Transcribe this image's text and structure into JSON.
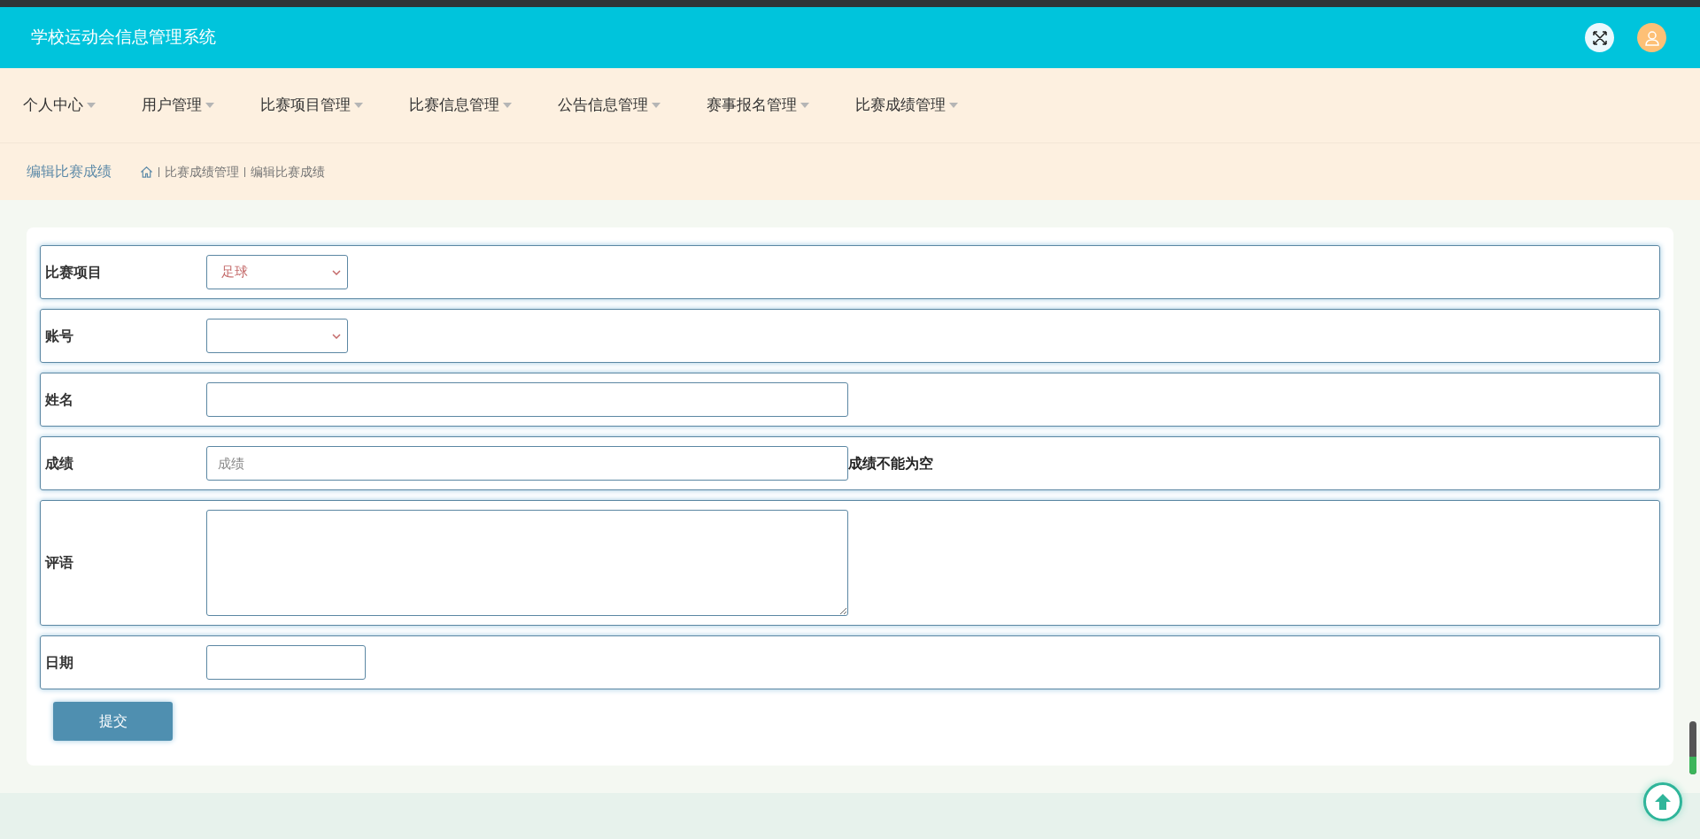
{
  "header": {
    "title": "学校运动会信息管理系统"
  },
  "nav": {
    "items": [
      {
        "label": "个人中心"
      },
      {
        "label": "用户管理"
      },
      {
        "label": "比赛项目管理"
      },
      {
        "label": "比赛信息管理"
      },
      {
        "label": "公告信息管理"
      },
      {
        "label": "赛事报名管理"
      },
      {
        "label": "比赛成绩管理"
      }
    ]
  },
  "breadcrumb": {
    "title": "编辑比赛成绩",
    "path": [
      "比赛成绩管理",
      "编辑比赛成绩"
    ]
  },
  "form": {
    "fields": [
      {
        "kind": "select",
        "label": "比赛项目",
        "value": "足球"
      },
      {
        "kind": "select",
        "label": "账号"
      },
      {
        "kind": "input",
        "label": "姓名"
      },
      {
        "kind": "input",
        "label": "成绩",
        "placeholder": "成绩",
        "error": "成绩不能为空"
      },
      {
        "kind": "textarea",
        "label": "评语"
      },
      {
        "kind": "date",
        "label": "日期"
      }
    ],
    "submit": "提交"
  }
}
